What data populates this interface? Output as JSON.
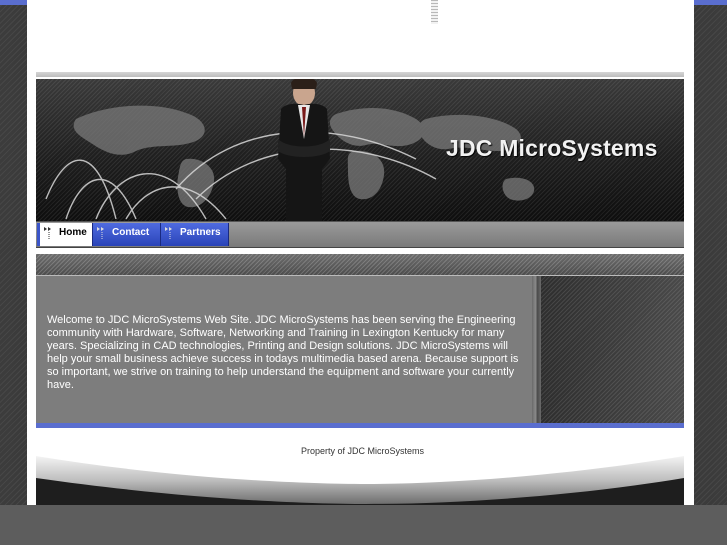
{
  "site": {
    "brand": "JDC MicroSystems"
  },
  "nav": {
    "tabs": [
      {
        "label": "Home",
        "active": true
      },
      {
        "label": "Contact",
        "active": false
      },
      {
        "label": "Partners",
        "active": false
      }
    ]
  },
  "content": {
    "welcome": "Welcome to JDC MicroSystems Web Site.  JDC MicroSystems has been serving the Engineering community with Hardware, Software, Networking and Training in Lexington Kentucky for many years.  Specializing in CAD technologies, Printing and Design solutions.  JDC MicroSystems will help your small business achieve success in todays multimedia based arena.  Because support is so important, we strive on training to help understand the equipment and software your currently have."
  },
  "footer": {
    "text": "Property of JDC MicroSystems"
  },
  "colors": {
    "accent_blue": "#5a6ecf",
    "tab_blue": "#3b55c9",
    "content_gray": "#7d7d7d"
  }
}
